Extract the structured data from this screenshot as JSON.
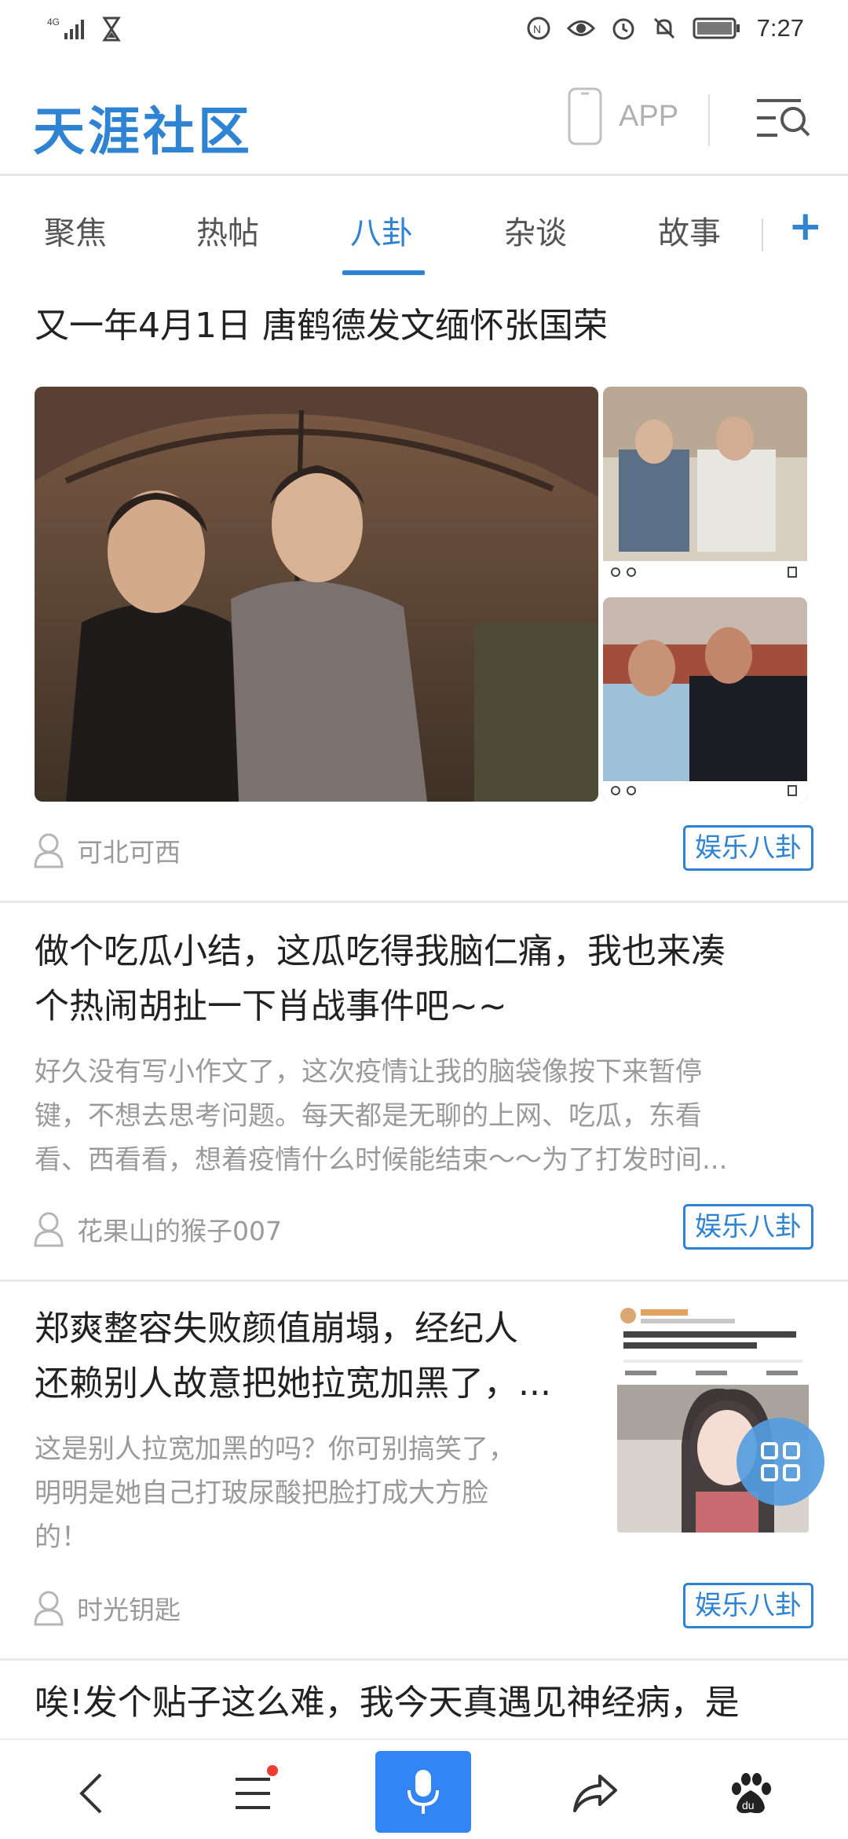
{
  "status_bar": {
    "network": "4G",
    "time": "7:27",
    "icons": [
      "signal-icon",
      "hourglass-icon",
      "nfc-icon",
      "eye-icon",
      "alarm-icon",
      "mute-icon",
      "battery-icon"
    ]
  },
  "header": {
    "logo": "天涯社区",
    "app_label": "APP",
    "menu_icon": "menu-search-icon"
  },
  "tabs": {
    "items": [
      {
        "label": "聚焦"
      },
      {
        "label": "热帖"
      },
      {
        "label": "八卦"
      },
      {
        "label": "杂谈"
      },
      {
        "label": "故事"
      }
    ],
    "active": "八卦",
    "add_label": "+"
  },
  "feed": [
    {
      "title": "又一年4月1日 唐鹤德发文缅怀张国荣",
      "author": "可北可西",
      "tag": "娱乐八卦"
    },
    {
      "title_line1": "做个吃瓜小结，这瓜吃得我脑仁痛，我也来凑",
      "title_line2": "个热闹胡扯一下肖战事件吧~~",
      "excerpt_line1": "好久没有写小作文了，这次疫情让我的脑袋像按下来暂停",
      "excerpt_line2": "键，不想去思考问题。每天都是无聊的上网、吃瓜，东看",
      "excerpt_line3": "看、西看看，想着疫情什么时候能结束～～为了打发时间...",
      "author": "花果山的猴子007",
      "tag": "娱乐八卦"
    },
    {
      "title_line1": "郑爽整容失败颜值崩塌，经纪人",
      "title_line2": "还赖别人故意把她拉宽加黑了，...",
      "excerpt_line1": "这是别人拉宽加黑的吗？你可别搞笑了，",
      "excerpt_line2": "明明是她自己打玻尿酸把脸打成大方脸",
      "excerpt_line3": "的！",
      "author": "时光钥匙",
      "tag": "娱乐八卦"
    },
    {
      "title_line1": "唉!发个贴子这么难，我今天真遇见神经病，是"
    }
  ],
  "bottom_bar": {
    "icons": [
      "back-icon",
      "menu-icon",
      "microphone-icon",
      "share-icon",
      "baidu-paw-icon"
    ],
    "accent": "#3385f5"
  },
  "colors": {
    "brand": "#2f83d3",
    "text": "#222222",
    "muted": "#9a9a9a"
  }
}
